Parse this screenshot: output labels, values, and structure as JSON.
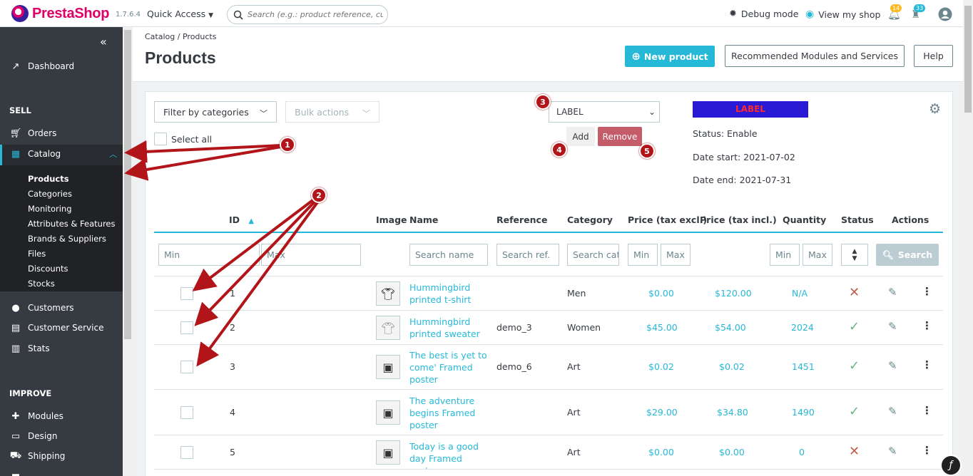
{
  "topbar": {
    "brand": "PrestaShop",
    "version": "1.7.6.4",
    "quick_access": "Quick Access",
    "search_placeholder": "Search (e.g.: product reference, custome",
    "debug_mode": "Debug mode",
    "view_shop": "View my shop",
    "notifications_count": "14",
    "orders_count": "33"
  },
  "sidebar": {
    "dashboard": "Dashboard",
    "sell_section": "SELL",
    "orders": "Orders",
    "catalog": "Catalog",
    "catalog_sub": [
      "Products",
      "Categories",
      "Monitoring",
      "Attributes & Features",
      "Brands & Suppliers",
      "Files",
      "Discounts",
      "Stocks"
    ],
    "customers": "Customers",
    "customer_service": "Customer Service",
    "stats": "Stats",
    "improve_section": "IMPROVE",
    "modules": "Modules",
    "design": "Design",
    "shipping": "Shipping"
  },
  "header": {
    "breadcrumb_catalog": "Catalog",
    "breadcrumb_sep": "/",
    "breadcrumb_products": "Products",
    "title": "Products",
    "new_product": "New product",
    "recommended": "Recommended Modules and Services",
    "help": "Help"
  },
  "toolbar": {
    "filter_categories": "Filter by categories",
    "bulk_actions": "Bulk actions",
    "select_all": "Select all",
    "label_select": "LABEL",
    "add": "Add",
    "remove": "Remove",
    "label_preview": "LABEL",
    "status": "Status: Enable",
    "date_start": "Date start: 2021-07-02",
    "date_end": "Date end: 2021-07-31"
  },
  "annotations": [
    "1",
    "2",
    "3",
    "4",
    "5"
  ],
  "table": {
    "headers": {
      "id": "ID",
      "image": "Image",
      "name": "Name",
      "reference": "Reference",
      "category": "Category",
      "price_excl": "Price (tax excl.)",
      "price_incl": "Price (tax incl.)",
      "quantity": "Quantity",
      "status": "Status",
      "actions": "Actions"
    },
    "filters": {
      "id_min": "Min",
      "id_max": "Max",
      "name": "Search name",
      "reference": "Search ref.",
      "category": "Search cat",
      "price_min": "Min",
      "price_max": "Max",
      "qty_min": "Min",
      "qty_max": "Max",
      "search": "Search"
    },
    "rows": [
      {
        "id": "1",
        "name": "Hummingbird printed t-shirt",
        "reference": "",
        "category": "Men",
        "price_excl": "$0.00",
        "price_incl": "$120.00",
        "quantity": "N/A",
        "status": "disabled"
      },
      {
        "id": "2",
        "name": "Hummingbird printed sweater",
        "reference": "demo_3",
        "category": "Women",
        "price_excl": "$45.00",
        "price_incl": "$54.00",
        "quantity": "2024",
        "status": "enabled"
      },
      {
        "id": "3",
        "name": "The best is yet to come' Framed poster",
        "reference": "demo_6",
        "category": "Art",
        "price_excl": "$0.02",
        "price_incl": "$0.02",
        "quantity": "1451",
        "status": "enabled"
      },
      {
        "id": "4",
        "name": "The adventure begins Framed poster",
        "reference": "",
        "category": "Art",
        "price_excl": "$29.00",
        "price_incl": "$34.80",
        "quantity": "1490",
        "status": "enabled"
      },
      {
        "id": "5",
        "name": "Today is a good day Framed poster",
        "reference": "",
        "category": "Art",
        "price_excl": "$0.00",
        "price_incl": "$0.00",
        "quantity": "0",
        "status": "disabled"
      }
    ]
  },
  "colors": {
    "accent": "#25b9d7",
    "sidebar": "#363a41",
    "annotation": "#b1151a",
    "enabled": "#70b580",
    "disabled": "#c45c4c",
    "label_bg": "#2a19d5",
    "label_text": "#ff2a2a"
  }
}
